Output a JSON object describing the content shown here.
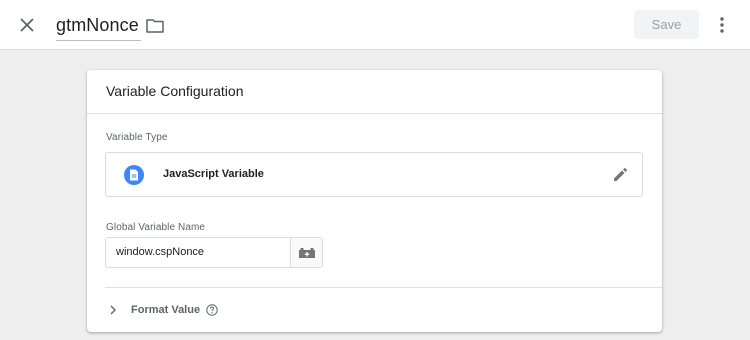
{
  "header": {
    "title": "gtmNonce",
    "save_label": "Save",
    "close_icon": "close-icon",
    "folder_icon": "folder-icon",
    "more_icon": "more-vert-icon"
  },
  "card": {
    "title": "Variable Configuration",
    "variable_type_label": "Variable Type",
    "variable_type": "JavaScript Variable",
    "global_name_label": "Global Variable Name",
    "global_name_value": "window.cspNonce",
    "format_value_label": "Format Value"
  },
  "colors": {
    "accent": "#4285f4",
    "background": "#eeeeee",
    "save_disabled_bg": "#f1f3f4"
  }
}
